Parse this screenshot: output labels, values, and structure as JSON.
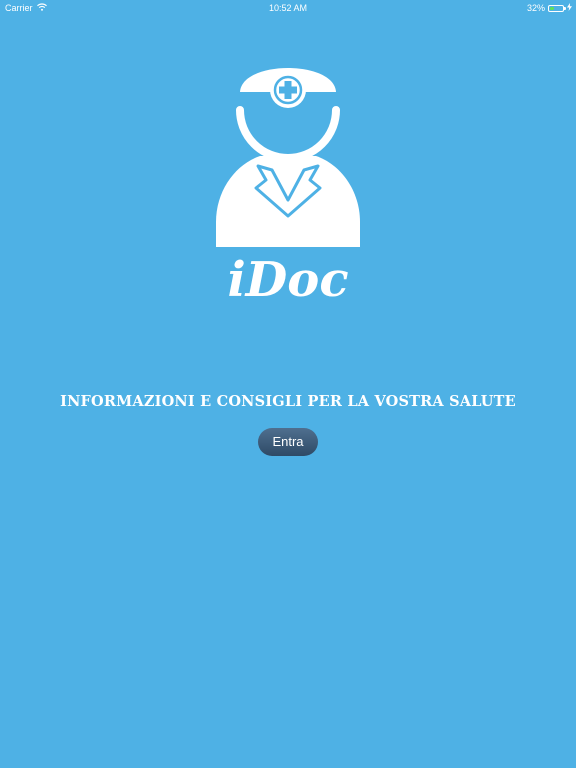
{
  "status_bar": {
    "carrier": "Carrier",
    "time": "10:52 AM",
    "battery_percent": "32%",
    "battery_level": 0.32,
    "battery_color": "#5ee05e",
    "wifi_icon": "wifi-icon",
    "charging_icon": "charging-bolt-icon"
  },
  "logo": {
    "text": "iDoc",
    "icon": "doctor-icon"
  },
  "tagline": "INFORMAZIONI E CONSIGLI PER LA VOSTRA SALUTE",
  "enter_button": {
    "label": "Entra"
  },
  "colors": {
    "background": "#4eb1e5",
    "button": "#3b5a7a",
    "text": "#ffffff"
  }
}
